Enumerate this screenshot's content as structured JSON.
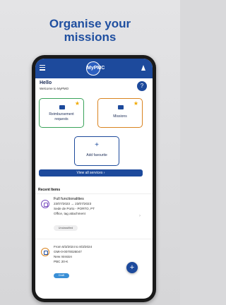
{
  "headline": {
    "line1": "Organise your",
    "line2": "missions"
  },
  "app": {
    "logo_text": "MyPMC",
    "hello": "Hello",
    "welcome": "Welcome to MyPMO"
  },
  "cards": {
    "reimbursement": {
      "line1": "Reimbursement",
      "line2": "requests"
    },
    "missions": {
      "label": "Missions"
    },
    "add_favourite": {
      "plus": "+",
      "label": "Add favourite"
    }
  },
  "view_all": {
    "label": "View all services  ›"
  },
  "recent": {
    "title": "Recent Items",
    "items": [
      {
        "title": "Full functionalities",
        "dates": "23/07/2023 → 23/07/2023",
        "location": "Sede de Porto - PORTO, PT",
        "detail": "Office, tag attachment",
        "tag": "Unclassified"
      },
      {
        "dates": "From 8/3/2024 to 8/3/2024",
        "id": "GMI-0-0070026047",
        "type": "New mission",
        "ref": "PBC 20-K",
        "tag": "Draft"
      }
    ]
  },
  "fab": {
    "label": "+"
  },
  "colors": {
    "primary": "#1d4a9c",
    "green": "#3aa35a",
    "orange": "#d9831f",
    "star": "#f0a800",
    "purple": "#7a4fc0"
  }
}
